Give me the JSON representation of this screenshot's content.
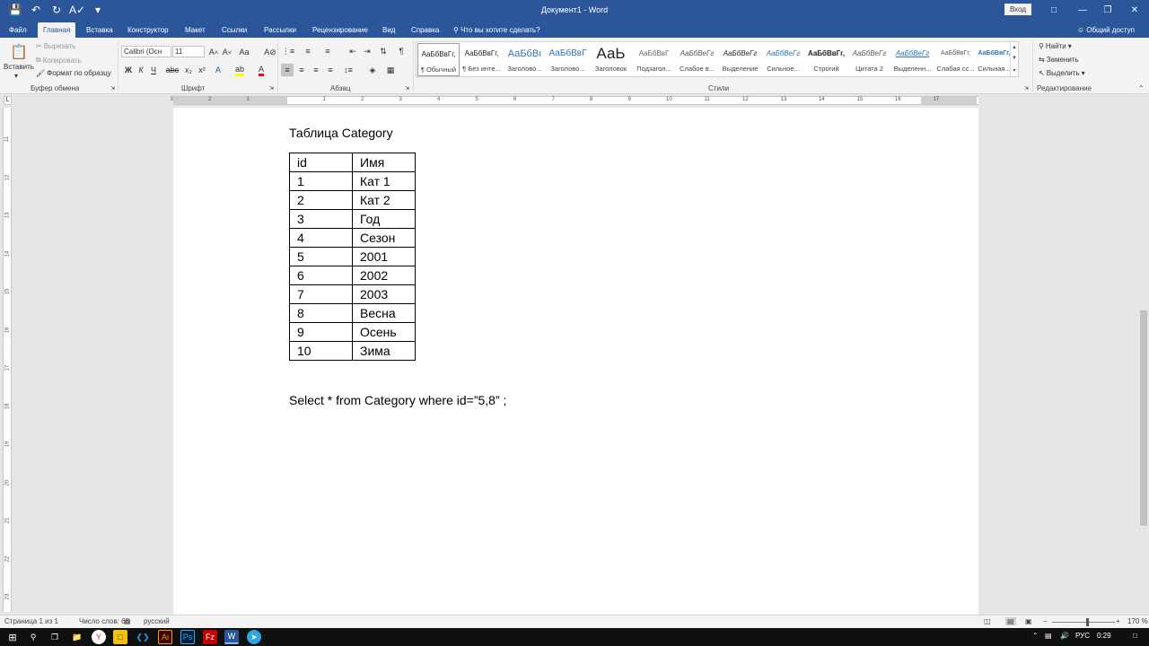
{
  "titlebar": {
    "document_title": "Документ1 - Word",
    "signin_label": "Вход"
  },
  "tabs": [
    {
      "label": "Файл"
    },
    {
      "label": "Главная"
    },
    {
      "label": "Вставка"
    },
    {
      "label": "Конструктор"
    },
    {
      "label": "Макет"
    },
    {
      "label": "Ссылки"
    },
    {
      "label": "Рассылки"
    },
    {
      "label": "Рецензирование"
    },
    {
      "label": "Вид"
    },
    {
      "label": "Справка"
    }
  ],
  "tell_me": "Что вы хотите сделать?",
  "share": "Общий доступ",
  "clipboard": {
    "paste": "Вставить",
    "cut": "Вырезать",
    "copy": "Копировать",
    "format_painter": "Формат по образцу",
    "group_label": "Буфер обмена"
  },
  "font": {
    "font_name": "Calibri (Осн",
    "font_size": "11",
    "bold": "Ж",
    "italic": "К",
    "underline": "Ч",
    "group_label": "Шрифт"
  },
  "paragraph": {
    "group_label": "Абзац"
  },
  "styles": {
    "group_label": "Стили",
    "items": [
      {
        "preview": "АаБбВвГг,",
        "name": "¶ Обычный"
      },
      {
        "preview": "АаБбВвГг,",
        "name": "¶ Без инте..."
      },
      {
        "preview": "АаБбВı",
        "name": "Заголово..."
      },
      {
        "preview": "АаБбВвГ",
        "name": "Заголово..."
      },
      {
        "preview": "АаЬ",
        "name": "Заголовок"
      },
      {
        "preview": "АаБбВвГ",
        "name": "Подзагол..."
      },
      {
        "preview": "АаБбВеГг",
        "name": "Слабое в..."
      },
      {
        "preview": "АаБбВеГг",
        "name": "Выделение"
      },
      {
        "preview": "АаБбВеГг",
        "name": "Сильное..."
      },
      {
        "preview": "АаБбВвГг,",
        "name": "Строгий"
      },
      {
        "preview": "АаБбВеГг",
        "name": "Цитата 2"
      },
      {
        "preview": "АаБбВеГг",
        "name": "Выделенн..."
      },
      {
        "preview": "АаБбВвГг,",
        "name": "Слабая сс..."
      },
      {
        "preview": "АаБбВвГг,",
        "name": "Сильная..."
      }
    ]
  },
  "editing": {
    "find": "Найти",
    "replace": "Заменить",
    "select": "Выделить",
    "group_label": "Редактирование"
  },
  "ruler": {
    "h_numbers": [
      "3",
      "2",
      "1",
      "1",
      "2",
      "3",
      "4",
      "5",
      "6",
      "7",
      "8",
      "9",
      "10",
      "11",
      "12",
      "13",
      "14",
      "15",
      "16",
      "17"
    ],
    "v_numbers": [
      "11",
      "12",
      "13",
      "14",
      "15",
      "16",
      "17",
      "18",
      "19",
      "20",
      "21",
      "22",
      "23"
    ],
    "corner": "L"
  },
  "document": {
    "heading": "Таблица Category",
    "table": [
      [
        "id",
        "Имя"
      ],
      [
        "1",
        "Кат 1"
      ],
      [
        "2",
        "Кат 2"
      ],
      [
        "3",
        "Год"
      ],
      [
        "4",
        "Сезон"
      ],
      [
        "5",
        "2001"
      ],
      [
        "6",
        "2002"
      ],
      [
        "7",
        "2003"
      ],
      [
        "8",
        "Весна"
      ],
      [
        "9",
        "Осень"
      ],
      [
        "10",
        "Зима"
      ]
    ],
    "sql": "Select * from Category where id=”5,8” ;"
  },
  "status": {
    "page": "Страница 1 из 1",
    "words": "Число слов: 68",
    "language": "русский",
    "zoom_minus": "−",
    "zoom_plus": "+",
    "zoom": "170 %"
  },
  "taskbar": {
    "lang": "РУС",
    "time": "0:29"
  }
}
